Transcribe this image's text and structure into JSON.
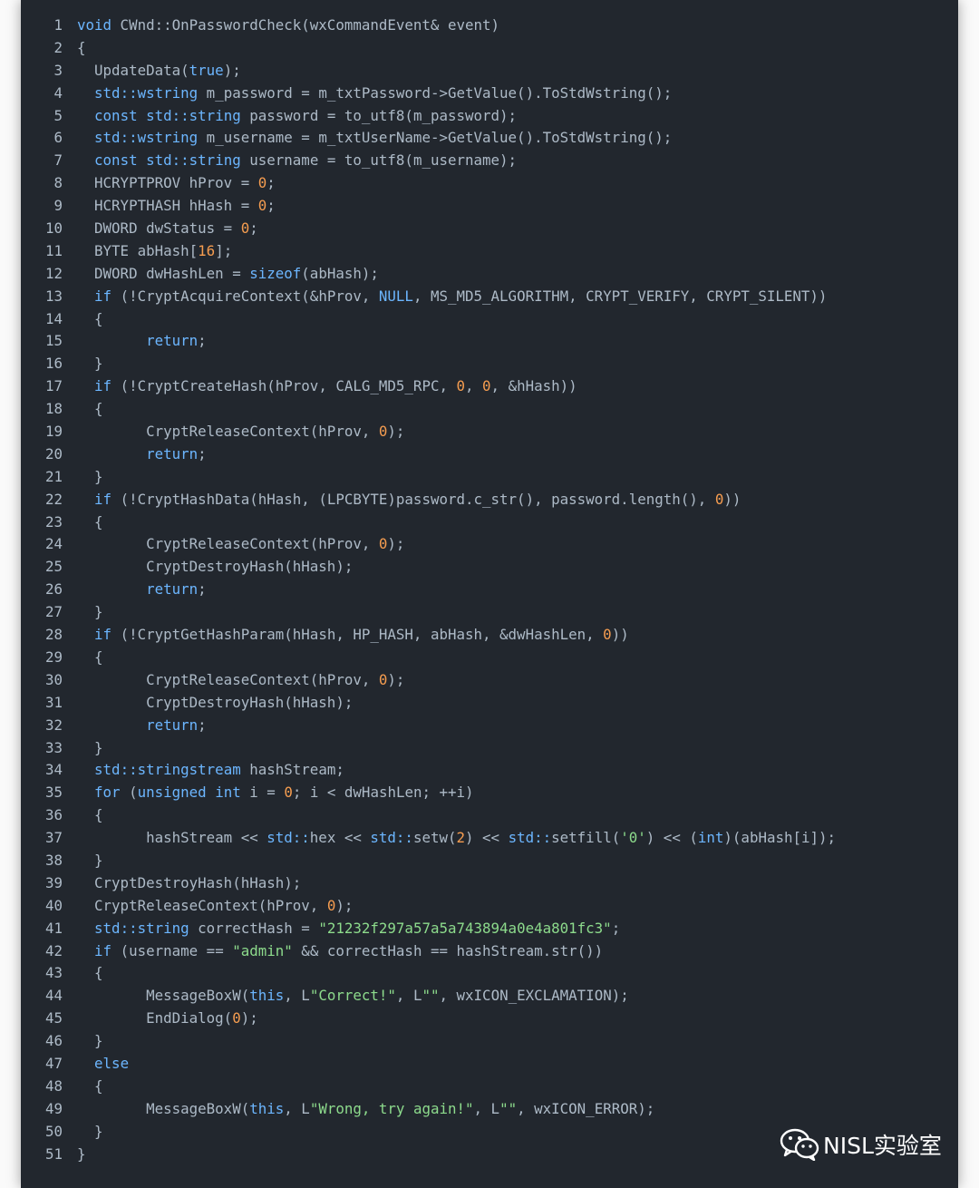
{
  "colors": {
    "background": "#22272e",
    "text": "#adbac7",
    "keyword": "#6cb6ff",
    "number": "#f69d50",
    "string": "#96d0ff"
  },
  "watermark": {
    "icon": "wechat-icon",
    "text": "NISL实验室"
  },
  "code_lines": [
    {
      "n": "1",
      "tokens": [
        {
          "t": "void",
          "c": "kw"
        },
        {
          "t": " CWnd::OnPasswordCheck(wxCommandEvent& event)",
          "c": "plain"
        }
      ]
    },
    {
      "n": "2",
      "tokens": [
        {
          "t": "{",
          "c": "plain"
        }
      ]
    },
    {
      "n": "3",
      "tokens": [
        {
          "t": "  UpdateData(",
          "c": "plain"
        },
        {
          "t": "true",
          "c": "kw"
        },
        {
          "t": ");",
          "c": "plain"
        }
      ]
    },
    {
      "n": "4",
      "tokens": [
        {
          "t": "  ",
          "c": "plain"
        },
        {
          "t": "std::wstring",
          "c": "ty"
        },
        {
          "t": " m_password = m_txtPassword->GetValue().ToStdWstring();",
          "c": "plain"
        }
      ]
    },
    {
      "n": "5",
      "tokens": [
        {
          "t": "  ",
          "c": "plain"
        },
        {
          "t": "const",
          "c": "kw"
        },
        {
          "t": " ",
          "c": "plain"
        },
        {
          "t": "std::string",
          "c": "ty"
        },
        {
          "t": " password = to_utf8(m_password);",
          "c": "plain"
        }
      ]
    },
    {
      "n": "6",
      "tokens": [
        {
          "t": "  ",
          "c": "plain"
        },
        {
          "t": "std::wstring",
          "c": "ty"
        },
        {
          "t": " m_username = m_txtUserName->GetValue().ToStdWstring();",
          "c": "plain"
        }
      ]
    },
    {
      "n": "7",
      "tokens": [
        {
          "t": "  ",
          "c": "plain"
        },
        {
          "t": "const",
          "c": "kw"
        },
        {
          "t": " ",
          "c": "plain"
        },
        {
          "t": "std::string",
          "c": "ty"
        },
        {
          "t": " username = to_utf8(m_username);",
          "c": "plain"
        }
      ]
    },
    {
      "n": "8",
      "tokens": [
        {
          "t": "  HCRYPTPROV hProv = ",
          "c": "plain"
        },
        {
          "t": "0",
          "c": "num"
        },
        {
          "t": ";",
          "c": "plain"
        }
      ]
    },
    {
      "n": "9",
      "tokens": [
        {
          "t": "  HCRYPTHASH hHash = ",
          "c": "plain"
        },
        {
          "t": "0",
          "c": "num"
        },
        {
          "t": ";",
          "c": "plain"
        }
      ]
    },
    {
      "n": "10",
      "tokens": [
        {
          "t": "  DWORD dwStatus = ",
          "c": "plain"
        },
        {
          "t": "0",
          "c": "num"
        },
        {
          "t": ";",
          "c": "plain"
        }
      ]
    },
    {
      "n": "11",
      "tokens": [
        {
          "t": "  BYTE abHash[",
          "c": "plain"
        },
        {
          "t": "16",
          "c": "num"
        },
        {
          "t": "];",
          "c": "plain"
        }
      ]
    },
    {
      "n": "12",
      "tokens": [
        {
          "t": "  DWORD dwHashLen = ",
          "c": "plain"
        },
        {
          "t": "sizeof",
          "c": "kw"
        },
        {
          "t": "(abHash);",
          "c": "plain"
        }
      ]
    },
    {
      "n": "13",
      "tokens": [
        {
          "t": "  ",
          "c": "plain"
        },
        {
          "t": "if",
          "c": "kw"
        },
        {
          "t": " (!CryptAcquireContext(&hProv, ",
          "c": "plain"
        },
        {
          "t": "NULL",
          "c": "kw"
        },
        {
          "t": ", MS_MD5_ALGORITHM, CRYPT_VERIFY, CRYPT_SILENT))",
          "c": "plain"
        }
      ]
    },
    {
      "n": "14",
      "tokens": [
        {
          "t": "  {",
          "c": "plain"
        }
      ]
    },
    {
      "n": "15",
      "tokens": [
        {
          "t": "        ",
          "c": "plain"
        },
        {
          "t": "return",
          "c": "kw"
        },
        {
          "t": ";",
          "c": "plain"
        }
      ]
    },
    {
      "n": "16",
      "tokens": [
        {
          "t": "  }",
          "c": "plain"
        }
      ]
    },
    {
      "n": "17",
      "tokens": [
        {
          "t": "  ",
          "c": "plain"
        },
        {
          "t": "if",
          "c": "kw"
        },
        {
          "t": " (!CryptCreateHash(hProv, CALG_MD5_RPC, ",
          "c": "plain"
        },
        {
          "t": "0",
          "c": "num"
        },
        {
          "t": ", ",
          "c": "plain"
        },
        {
          "t": "0",
          "c": "num"
        },
        {
          "t": ", &hHash))",
          "c": "plain"
        }
      ]
    },
    {
      "n": "18",
      "tokens": [
        {
          "t": "  {",
          "c": "plain"
        }
      ]
    },
    {
      "n": "19",
      "tokens": [
        {
          "t": "        CryptReleaseContext(hProv, ",
          "c": "plain"
        },
        {
          "t": "0",
          "c": "num"
        },
        {
          "t": ");",
          "c": "plain"
        }
      ]
    },
    {
      "n": "20",
      "tokens": [
        {
          "t": "        ",
          "c": "plain"
        },
        {
          "t": "return",
          "c": "kw"
        },
        {
          "t": ";",
          "c": "plain"
        }
      ]
    },
    {
      "n": "21",
      "tokens": [
        {
          "t": "  }",
          "c": "plain"
        }
      ]
    },
    {
      "n": "22",
      "tokens": [
        {
          "t": "  ",
          "c": "plain"
        },
        {
          "t": "if",
          "c": "kw"
        },
        {
          "t": " (!CryptHashData(hHash, (LPCBYTE)password.c_str(), password.length(), ",
          "c": "plain"
        },
        {
          "t": "0",
          "c": "num"
        },
        {
          "t": "))",
          "c": "plain"
        }
      ]
    },
    {
      "n": "23",
      "tokens": [
        {
          "t": "  {",
          "c": "plain"
        }
      ]
    },
    {
      "n": "24",
      "tokens": [
        {
          "t": "        CryptReleaseContext(hProv, ",
          "c": "plain"
        },
        {
          "t": "0",
          "c": "num"
        },
        {
          "t": ");",
          "c": "plain"
        }
      ]
    },
    {
      "n": "25",
      "tokens": [
        {
          "t": "        CryptDestroyHash(hHash);",
          "c": "plain"
        }
      ]
    },
    {
      "n": "26",
      "tokens": [
        {
          "t": "        ",
          "c": "plain"
        },
        {
          "t": "return",
          "c": "kw"
        },
        {
          "t": ";",
          "c": "plain"
        }
      ]
    },
    {
      "n": "27",
      "tokens": [
        {
          "t": "  }",
          "c": "plain"
        }
      ]
    },
    {
      "n": "28",
      "tokens": [
        {
          "t": "  ",
          "c": "plain"
        },
        {
          "t": "if",
          "c": "kw"
        },
        {
          "t": " (!CryptGetHashParam(hHash, HP_HASH, abHash, &dwHashLen, ",
          "c": "plain"
        },
        {
          "t": "0",
          "c": "num"
        },
        {
          "t": "))",
          "c": "plain"
        }
      ]
    },
    {
      "n": "29",
      "tokens": [
        {
          "t": "  {",
          "c": "plain"
        }
      ]
    },
    {
      "n": "30",
      "tokens": [
        {
          "t": "        CryptReleaseContext(hProv, ",
          "c": "plain"
        },
        {
          "t": "0",
          "c": "num"
        },
        {
          "t": ");",
          "c": "plain"
        }
      ]
    },
    {
      "n": "31",
      "tokens": [
        {
          "t": "        CryptDestroyHash(hHash);",
          "c": "plain"
        }
      ]
    },
    {
      "n": "32",
      "tokens": [
        {
          "t": "        ",
          "c": "plain"
        },
        {
          "t": "return",
          "c": "kw"
        },
        {
          "t": ";",
          "c": "plain"
        }
      ]
    },
    {
      "n": "33",
      "tokens": [
        {
          "t": "  }",
          "c": "plain"
        }
      ]
    },
    {
      "n": "34",
      "tokens": [
        {
          "t": "  ",
          "c": "plain"
        },
        {
          "t": "std::stringstream",
          "c": "ty"
        },
        {
          "t": " hashStream;",
          "c": "plain"
        }
      ]
    },
    {
      "n": "35",
      "tokens": [
        {
          "t": "  ",
          "c": "plain"
        },
        {
          "t": "for",
          "c": "kw"
        },
        {
          "t": " (",
          "c": "plain"
        },
        {
          "t": "unsigned",
          "c": "kw"
        },
        {
          "t": " ",
          "c": "plain"
        },
        {
          "t": "int",
          "c": "kw"
        },
        {
          "t": " i = ",
          "c": "plain"
        },
        {
          "t": "0",
          "c": "num"
        },
        {
          "t": "; i < dwHashLen; ++i)",
          "c": "plain"
        }
      ]
    },
    {
      "n": "36",
      "tokens": [
        {
          "t": "  {",
          "c": "plain"
        }
      ]
    },
    {
      "n": "37",
      "tokens": [
        {
          "t": "        hashStream << ",
          "c": "plain"
        },
        {
          "t": "std::",
          "c": "ns"
        },
        {
          "t": "hex << ",
          "c": "plain"
        },
        {
          "t": "std::",
          "c": "ns"
        },
        {
          "t": "setw(",
          "c": "plain"
        },
        {
          "t": "2",
          "c": "num"
        },
        {
          "t": ") << ",
          "c": "plain"
        },
        {
          "t": "std::",
          "c": "ns"
        },
        {
          "t": "setfill(",
          "c": "plain"
        },
        {
          "t": "'0'",
          "c": "str2"
        },
        {
          "t": ") << (",
          "c": "plain"
        },
        {
          "t": "int",
          "c": "kw"
        },
        {
          "t": ")(abHash[i]);",
          "c": "plain"
        }
      ]
    },
    {
      "n": "38",
      "tokens": [
        {
          "t": "  }",
          "c": "plain"
        }
      ]
    },
    {
      "n": "39",
      "tokens": [
        {
          "t": "  CryptDestroyHash(hHash);",
          "c": "plain"
        }
      ]
    },
    {
      "n": "40",
      "tokens": [
        {
          "t": "  CryptReleaseContext(hProv, ",
          "c": "plain"
        },
        {
          "t": "0",
          "c": "num"
        },
        {
          "t": ");",
          "c": "plain"
        }
      ]
    },
    {
      "n": "41",
      "tokens": [
        {
          "t": "  ",
          "c": "plain"
        },
        {
          "t": "std::string",
          "c": "ty"
        },
        {
          "t": " correctHash = ",
          "c": "plain"
        },
        {
          "t": "\"21232f297a57a5a743894a0e4a801fc3\"",
          "c": "str2"
        },
        {
          "t": ";",
          "c": "plain"
        }
      ]
    },
    {
      "n": "42",
      "tokens": [
        {
          "t": "  ",
          "c": "plain"
        },
        {
          "t": "if",
          "c": "kw"
        },
        {
          "t": " (username == ",
          "c": "plain"
        },
        {
          "t": "\"admin\"",
          "c": "str2"
        },
        {
          "t": " && correctHash == hashStream.str())",
          "c": "plain"
        }
      ]
    },
    {
      "n": "43",
      "tokens": [
        {
          "t": "  {",
          "c": "plain"
        }
      ]
    },
    {
      "n": "44",
      "tokens": [
        {
          "t": "        MessageBoxW(",
          "c": "plain"
        },
        {
          "t": "this",
          "c": "kw"
        },
        {
          "t": ", L",
          "c": "plain"
        },
        {
          "t": "\"Correct!\"",
          "c": "str2"
        },
        {
          "t": ", L",
          "c": "plain"
        },
        {
          "t": "\"\"",
          "c": "str2"
        },
        {
          "t": ", wxICON_EXCLAMATION);",
          "c": "plain"
        }
      ]
    },
    {
      "n": "45",
      "tokens": [
        {
          "t": "        EndDialog(",
          "c": "plain"
        },
        {
          "t": "0",
          "c": "num"
        },
        {
          "t": ");",
          "c": "plain"
        }
      ]
    },
    {
      "n": "46",
      "tokens": [
        {
          "t": "  }",
          "c": "plain"
        }
      ]
    },
    {
      "n": "47",
      "tokens": [
        {
          "t": "  ",
          "c": "plain"
        },
        {
          "t": "else",
          "c": "kw"
        }
      ]
    },
    {
      "n": "48",
      "tokens": [
        {
          "t": "  {",
          "c": "plain"
        }
      ]
    },
    {
      "n": "49",
      "tokens": [
        {
          "t": "        MessageBoxW(",
          "c": "plain"
        },
        {
          "t": "this",
          "c": "kw"
        },
        {
          "t": ", L",
          "c": "plain"
        },
        {
          "t": "\"Wrong, try again!\"",
          "c": "str2"
        },
        {
          "t": ", L",
          "c": "plain"
        },
        {
          "t": "\"\"",
          "c": "str2"
        },
        {
          "t": ", wxICON_ERROR);",
          "c": "plain"
        }
      ]
    },
    {
      "n": "50",
      "tokens": [
        {
          "t": "  }",
          "c": "plain"
        }
      ]
    },
    {
      "n": "51",
      "tokens": [
        {
          "t": "}",
          "c": "plain"
        }
      ]
    }
  ]
}
